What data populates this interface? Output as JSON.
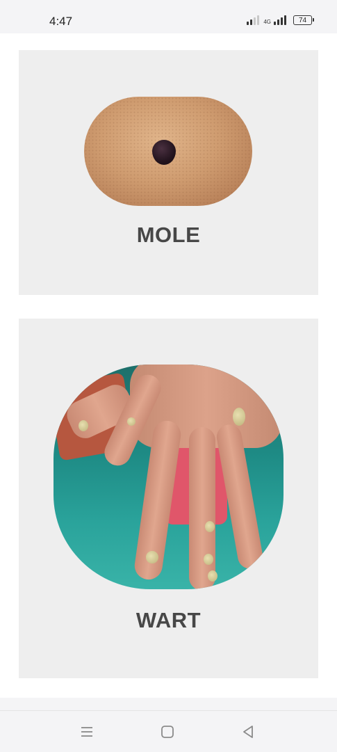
{
  "status_bar": {
    "time": "4:47",
    "network": "4G",
    "battery": "74"
  },
  "cards": [
    {
      "label": "MOLE",
      "image_icon": "mole-photo"
    },
    {
      "label": "WART",
      "image_icon": "wart-hand-photo"
    }
  ],
  "navigation": {
    "menu_icon": "menu-icon",
    "home_icon": "home-icon",
    "back_icon": "back-icon"
  }
}
